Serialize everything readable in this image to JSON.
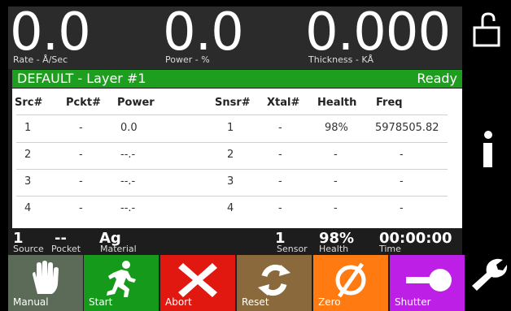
{
  "readouts": [
    {
      "value": "0.0",
      "label": "Rate - Å/Sec"
    },
    {
      "value": "0.0",
      "label": "Power - %"
    },
    {
      "value": "0.000",
      "label": "Thickness - KÅ"
    }
  ],
  "banner": {
    "left": "DEFAULT - Layer #1",
    "right": "Ready"
  },
  "table": {
    "headers": [
      "Src#",
      "Pckt#",
      "Power",
      "Snsr#",
      "Xtal#",
      "Health",
      "Freq"
    ],
    "rows": [
      [
        "1",
        "-",
        "0.0",
        "1",
        "-",
        "98%",
        "5978505.82"
      ],
      [
        "2",
        "-",
        "--.-",
        "2",
        "-",
        "-",
        "-"
      ],
      [
        "3",
        "-",
        "--.-",
        "3",
        "-",
        "-",
        "-"
      ],
      [
        "4",
        "-",
        "--.-",
        "4",
        "-",
        "-",
        "-"
      ]
    ]
  },
  "status": {
    "source": {
      "value": "1",
      "label": "Source"
    },
    "pocket": {
      "value": "--",
      "label": "Pocket"
    },
    "material": {
      "value": "Ag",
      "label": "Material"
    },
    "sensor": {
      "value": "1",
      "label": "Sensor"
    },
    "health": {
      "value": "98%",
      "label": "Health"
    },
    "time": {
      "value": "00:00:00",
      "label": "Time"
    }
  },
  "buttons": [
    {
      "label": "Manual",
      "color": "#5b6b57",
      "icon": "hand-icon"
    },
    {
      "label": "Start",
      "color": "#159a1c",
      "icon": "running-man-icon"
    },
    {
      "label": "Abort",
      "color": "#e0180f",
      "icon": "x-icon"
    },
    {
      "label": "Reset",
      "color": "#8a6a3c",
      "icon": "refresh-icon"
    },
    {
      "label": "Zero",
      "color": "#ff7a10",
      "icon": "empty-set-icon"
    },
    {
      "label": "Shutter",
      "color": "#bd1fe6",
      "icon": "shutter-icon"
    }
  ],
  "side": {
    "icons": [
      "lock-icon",
      "info-icon",
      "wrench-icon"
    ]
  }
}
